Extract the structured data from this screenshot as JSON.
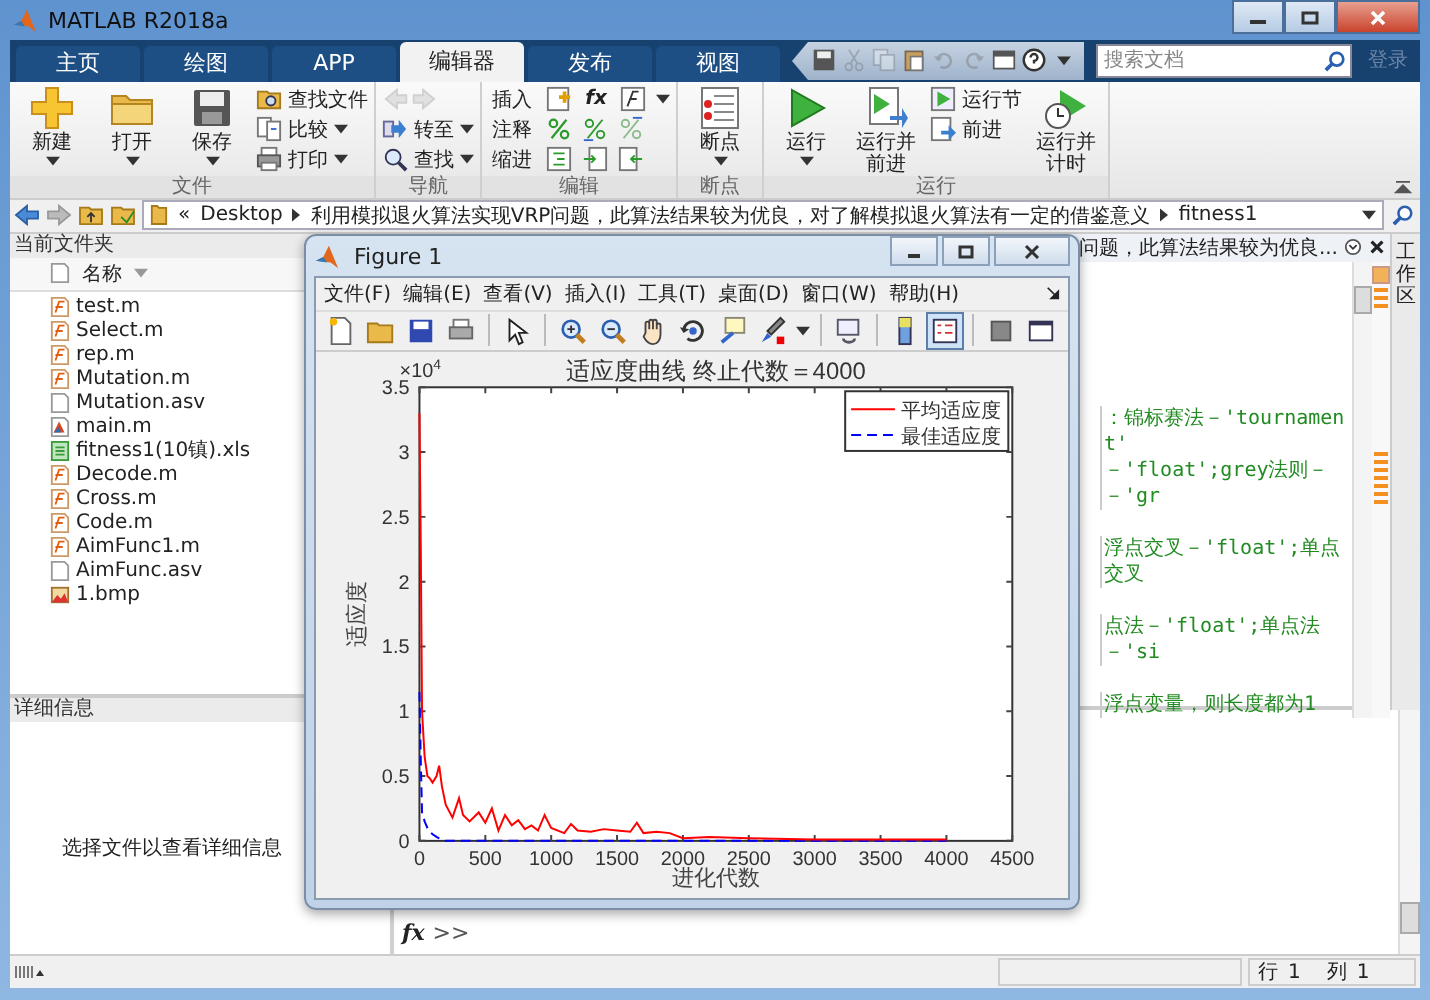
{
  "window": {
    "title": "MATLAB R2018a"
  },
  "tabs": [
    {
      "label": "主页",
      "selected": false
    },
    {
      "label": "绘图",
      "selected": false
    },
    {
      "label": "APP",
      "selected": false
    },
    {
      "label": "编辑器",
      "selected": true
    },
    {
      "label": "发布",
      "selected": false
    },
    {
      "label": "视图",
      "selected": false
    }
  ],
  "quick_access": [
    {
      "disabled": false
    },
    {
      "disabled": true
    },
    {
      "disabled": true
    },
    {
      "disabled": false
    },
    {
      "disabled": true
    },
    {
      "disabled": true
    },
    {
      "disabled": false
    },
    {
      "disabled": false
    },
    {
      "disabled": false
    }
  ],
  "search": {
    "placeholder": "搜索文档"
  },
  "sign_in": "登录",
  "ribbon": {
    "groups": [
      {
        "title": "文件",
        "items": [
          {
            "kind": "large",
            "label": "新建",
            "dropdown": true
          },
          {
            "kind": "large",
            "label": "打开",
            "dropdown": true
          },
          {
            "kind": "large",
            "label": "保存",
            "dropdown": true
          },
          {
            "kind": "stack",
            "rows": [
              {
                "label": "查找文件",
                "dropdown": false,
                "disabled": false
              },
              {
                "label": "比较",
                "dropdown": true,
                "disabled": false
              },
              {
                "label": "打印",
                "dropdown": true,
                "disabled": false
              }
            ]
          }
        ]
      },
      {
        "title": "导航",
        "items": [
          {
            "kind": "stack",
            "rows": [
              {
                "dropdown": false,
                "disabled": true
              },
              {
                "label": "转至",
                "dropdown": true,
                "disabled": false
              },
              {
                "label": "查找",
                "dropdown": true,
                "disabled": false
              }
            ]
          }
        ]
      },
      {
        "title": "编辑",
        "items": [
          {
            "kind": "grid",
            "rows": [
              {
                "label": "插入",
                "symbol": "fx",
                "dropdown": true
              },
              {
                "label": "注释",
                "dropdown": false
              },
              {
                "label": "缩进",
                "dropdown": false
              }
            ]
          }
        ]
      },
      {
        "title": "断点",
        "items": [
          {
            "kind": "large",
            "label": "断点",
            "dropdown": true
          }
        ]
      },
      {
        "title": "运行",
        "items": [
          {
            "kind": "large",
            "label": "运行",
            "dropdown": true
          },
          {
            "kind": "large",
            "label": "运行并前进",
            "dropdown": false
          },
          {
            "kind": "stack",
            "rows": [
              {
                "label": "运行节",
                "dropdown": false,
                "disabled": false
              },
              {
                "label": "前进",
                "dropdown": false,
                "disabled": false
              }
            ]
          },
          {
            "kind": "large",
            "label": "运行并计时",
            "dropdown": false
          }
        ]
      }
    ]
  },
  "address": {
    "overflow_mark": "«",
    "segments": [
      "Desktop",
      "利用模拟退火算法实现VRP问题，此算法结果较为优良，对了解模拟退火算法有一定的借鉴意义",
      "fitness1"
    ]
  },
  "current_folder": {
    "title": "当前文件夹",
    "column": "名称",
    "files": [
      {
        "name": "test.m",
        "kind": "function"
      },
      {
        "name": "Select.m",
        "kind": "function"
      },
      {
        "name": "rep.m",
        "kind": "function"
      },
      {
        "name": "Mutation.m",
        "kind": "function"
      },
      {
        "name": "Mutation.asv",
        "kind": "plain"
      },
      {
        "name": "main.m",
        "kind": "script"
      },
      {
        "name": "fitness1(10镇).xls",
        "kind": "spreadsheet"
      },
      {
        "name": "Decode.m",
        "kind": "function"
      },
      {
        "name": "Cross.m",
        "kind": "function"
      },
      {
        "name": "Code.m",
        "kind": "function"
      },
      {
        "name": "AimFunc1.m",
        "kind": "function"
      },
      {
        "name": "AimFunc.asv",
        "kind": "plain"
      },
      {
        "name": "1.bmp",
        "kind": "image"
      }
    ]
  },
  "details": {
    "title": "详细信息",
    "message": "选择文件以查看详细信息"
  },
  "editor": {
    "tab_label": "问题，此算法结果较为优良...",
    "lines": [
      {
        "text": "：锦标赛法－'tournament'"
      },
      {
        "text": "－'float';grey法则－－'gr"
      },
      {
        "text": "浮点交叉－'float';单点交叉"
      },
      {
        "text": "点法－'float';单点法－'si"
      },
      {
        "text": "浮点变量，则长度都为1"
      }
    ]
  },
  "workspace_tab": "工作区",
  "command_window": {
    "symbol": "fx",
    "prompt": ">>"
  },
  "status_bar": {
    "row_label": "行",
    "row": "1",
    "col_label": "列",
    "col": "1"
  },
  "figure": {
    "title": "Figure 1",
    "menu": [
      "文件(F)",
      "编辑(E)",
      "查看(V)",
      "插入(I)",
      "工具(T)",
      "桌面(D)",
      "窗口(W)",
      "帮助(H)"
    ],
    "toolbar": [
      {
        "pressed": false
      },
      {
        "pressed": false
      },
      {
        "pressed": false
      },
      {
        "pressed": false
      },
      {
        "pressed": false
      },
      {
        "pressed": false
      },
      {
        "pressed": false
      },
      {
        "pressed": false
      },
      {
        "pressed": false
      },
      {
        "pressed": false
      },
      {
        "pressed": false
      },
      {
        "pressed": false
      },
      {
        "pressed": false
      },
      {
        "pressed": true
      },
      {
        "pressed": false
      },
      {
        "pressed": false
      }
    ],
    "y_exponent": {
      "base": "×10",
      "power": "4"
    },
    "chart_data": {
      "type": "line",
      "title": "适应度曲线  终止代数＝4000",
      "xlabel": "进化代数",
      "ylabel": "适应度",
      "x": [
        0,
        10,
        20,
        40,
        60,
        80,
        100,
        130,
        150,
        170,
        200,
        250,
        300,
        330,
        380,
        450,
        500,
        550,
        600,
        650,
        700,
        750,
        800,
        850,
        900,
        950,
        1000,
        1100,
        1150,
        1200,
        1300,
        1400,
        1500,
        1600,
        1650,
        1700,
        1800,
        1900,
        2000,
        2200,
        2500,
        3000,
        3500,
        4000
      ],
      "series": [
        {
          "name": "平均适应度",
          "color": "#ff0000",
          "line_style": "solid",
          "values": [
            3.3,
            2.2,
            1.0,
            0.65,
            0.5,
            0.48,
            0.45,
            0.5,
            0.58,
            0.42,
            0.28,
            0.18,
            0.33,
            0.2,
            0.15,
            0.22,
            0.14,
            0.25,
            0.08,
            0.2,
            0.12,
            0.16,
            0.09,
            0.12,
            0.08,
            0.2,
            0.1,
            0.06,
            0.13,
            0.08,
            0.07,
            0.09,
            0.08,
            0.07,
            0.14,
            0.06,
            0.07,
            0.06,
            0.02,
            0.03,
            0.02,
            0.01,
            0.01,
            0.01
          ]
        },
        {
          "name": "最佳适应度",
          "color": "#0000ff",
          "line_style": "dashed",
          "values": [
            1.15,
            0.6,
            0.22,
            0.15,
            0.1,
            0.07,
            0.05,
            0.03,
            0.02,
            0.01,
            0,
            0,
            0,
            0,
            0,
            0,
            0,
            0,
            0,
            0,
            0,
            0,
            0,
            0,
            0,
            0,
            0,
            0,
            0,
            0,
            0,
            0,
            0,
            0,
            0,
            0,
            0,
            0,
            0,
            0,
            0,
            0,
            0,
            0
          ]
        }
      ],
      "legend": "upper right",
      "xlim": [
        0,
        4500
      ],
      "ylim": [
        0,
        3.5
      ],
      "xticks": [
        0,
        500,
        1000,
        1500,
        2000,
        2500,
        3000,
        3500,
        4000,
        4500
      ],
      "yticks": [
        0,
        0.5,
        1,
        1.5,
        2,
        2.5,
        3,
        3.5
      ]
    }
  }
}
